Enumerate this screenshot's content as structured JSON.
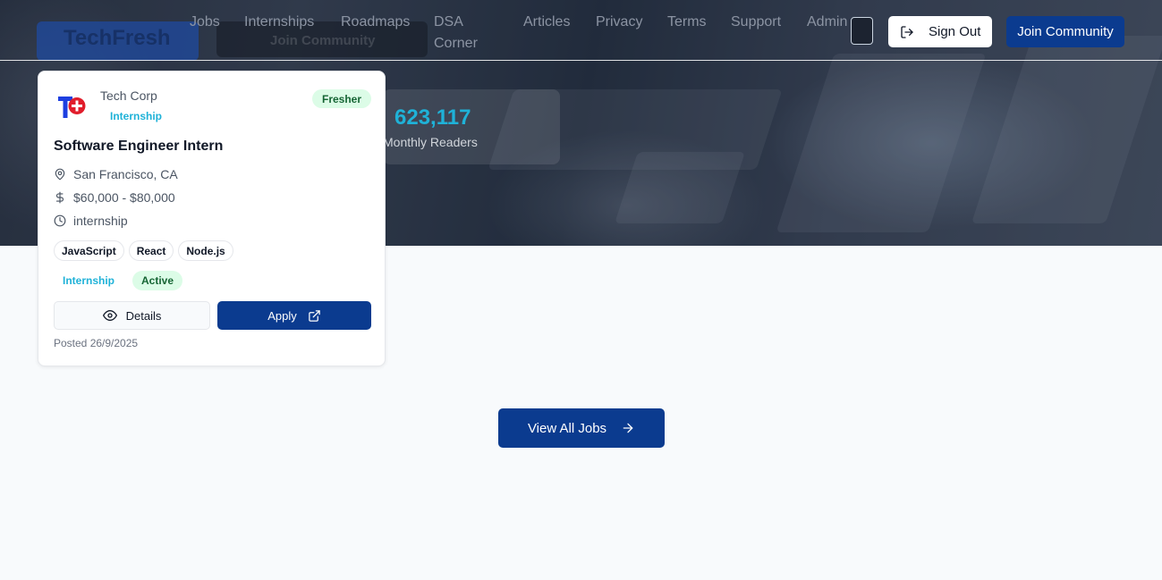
{
  "hero": {
    "ghost_brand": "TechFresh",
    "ghost_button": "Join Community",
    "stats": {
      "value": "623,117",
      "label": "Monthly Readers"
    }
  },
  "nav": {
    "links": [
      "Jobs",
      "Internships",
      "Roadmaps",
      "DSA",
      "Corner",
      "Articles",
      "Privacy",
      "Terms",
      "Support",
      "Admin"
    ],
    "sign_out": "Sign Out",
    "join": "Join Community"
  },
  "job_card": {
    "company": "Tech Corp",
    "type_tag": "Internship",
    "level_badge": "Fresher",
    "title": "Software Engineer Intern",
    "location": "San Francisco, CA",
    "salary": "$60,000 - $80,000",
    "employment": "internship",
    "skills": [
      "JavaScript",
      "React",
      "Node.js"
    ],
    "badges": {
      "type": "Internship",
      "status": "Active"
    },
    "details_label": "Details",
    "apply_label": "Apply",
    "posted": "Posted 26/9/2025"
  },
  "view_all_label": "View All Jobs",
  "colors": {
    "primary": "#0b3b8f",
    "accent": "#1fb2d8",
    "success_bg": "#dcfce7",
    "success_text": "#166534"
  }
}
